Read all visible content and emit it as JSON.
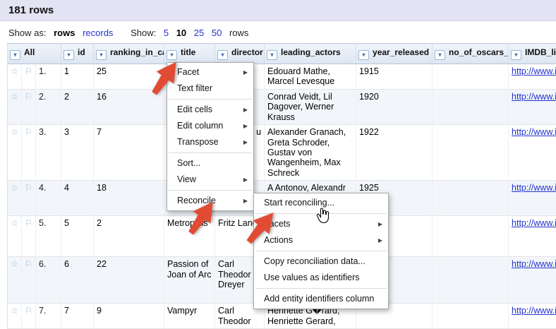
{
  "header": {
    "title": "181 rows"
  },
  "toolbar": {
    "show_as_label": "Show as:",
    "rows_option": "rows",
    "records_option": "records",
    "show_label": "Show:",
    "page_sizes": [
      "5",
      "10",
      "25",
      "50"
    ],
    "rows_suffix": "rows"
  },
  "icons": {
    "caret": "▾",
    "submenu_arrow": "▶",
    "star": "☆",
    "flag": "⚐"
  },
  "table": {
    "columns": {
      "all": "All",
      "id": "id",
      "ranking": "ranking_in_cate",
      "title": "title",
      "director": "director",
      "actors": "leading_actors",
      "year": "year_released",
      "oscars": "no_of_oscars_w",
      "imdb": "IMDB_lin"
    },
    "rows": [
      {
        "index": "1.",
        "id": "1",
        "ranking": "25",
        "title": "",
        "director": "",
        "actors": "Edouard Mathe, Marcel Levesque",
        "year": "1915",
        "oscars": "",
        "imdb": "http://www.im"
      },
      {
        "index": "2.",
        "id": "2",
        "ranking": "16",
        "title": "",
        "director": "",
        "actors": "Conrad Veidt, Lil Dagover, Werner Krauss",
        "year": "1920",
        "oscars": "",
        "imdb": "http://www.im"
      },
      {
        "index": "3.",
        "id": "3",
        "ranking": "7",
        "title": "",
        "director": "u",
        "actors": "Alexander Granach, Greta Schroder, Gustav von Wangenheim, Max Schreck",
        "year": "1922",
        "oscars": "",
        "imdb": "http://www.im"
      },
      {
        "index": "4.",
        "id": "4",
        "ranking": "18",
        "title": "",
        "director": "",
        "actors": "A Antonov, Alexandr Antonov, Grigori Alexandrov, Midhail",
        "year": "1925",
        "oscars": "",
        "imdb": "http://www.im"
      },
      {
        "index": "5.",
        "id": "5",
        "ranking": "2",
        "title": "Metropolis",
        "director": "Fritz Lang",
        "actors": "",
        "year": "",
        "oscars": "",
        "imdb": "http://www.im"
      },
      {
        "index": "6.",
        "id": "6",
        "ranking": "22",
        "title": "Passion of Joan of Arc",
        "director": "Carl Theodor Dreyer",
        "actors": "",
        "year": "",
        "oscars": "",
        "imdb": "http://www.im"
      },
      {
        "index": "7.",
        "id": "7",
        "ranking": "9",
        "title": "Vampyr",
        "director": "Carl Theodor",
        "actors": "Henriette G�rard, Henriette Gerard,",
        "year": "",
        "oscars": "",
        "imdb": "http://www.im"
      }
    ]
  },
  "column_menu": {
    "facet": "Facet",
    "text_filter": "Text filter",
    "edit_cells": "Edit cells",
    "edit_column": "Edit column",
    "transpose": "Transpose",
    "sort": "Sort...",
    "view": "View",
    "reconcile": "Reconcile"
  },
  "reconcile_menu": {
    "start": "Start reconciling...",
    "facets": "Facets",
    "actions": "Actions",
    "copy": "Copy reconciliation data...",
    "use_values": "Use values as identifiers",
    "add_entity": "Add entity identifiers column"
  },
  "annotation": {
    "arrow_color": "#E14B33"
  }
}
